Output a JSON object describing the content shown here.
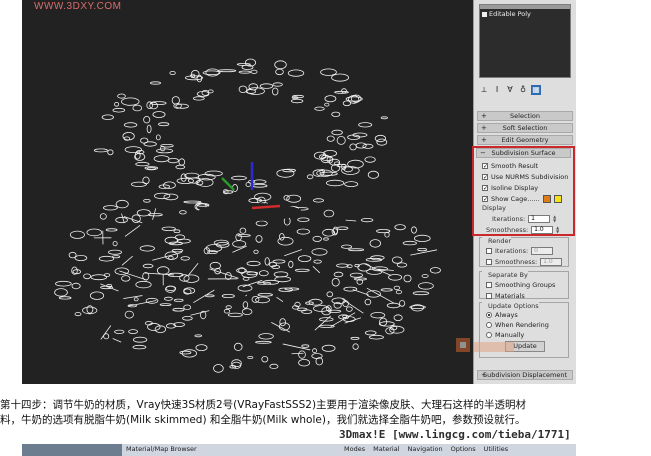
{
  "watermark_top": "WWW.3DXY.COM",
  "viewport": {
    "label": "wireframe-viewport"
  },
  "panel": {
    "modifier_item": "Editable Poly",
    "rollouts": {
      "selection": "Selection",
      "soft_selection": "Soft Selection",
      "edit_geometry": "Edit Geometry",
      "subdivision_surface": "Subdivision Surface",
      "subdivision_displacement": "Subdivision Displacement"
    },
    "subdivision": {
      "smooth_result": "Smooth Result",
      "use_nurms": "Use NURMS Subdivision",
      "isoline_display": "Isoline Display",
      "show_cage": "Show Cage......",
      "display_label": "Display",
      "iterations_label": "Iterations:",
      "iterations_value": "1",
      "smoothness_label": "Smoothness:",
      "smoothness_value": "1.0",
      "cage_colors": [
        "#e07b17",
        "#f5e21a"
      ]
    },
    "render": {
      "label": "Render",
      "iterations_label": "Iterations:",
      "iterations_value": "0",
      "smoothness_label": "Smoothness:",
      "smoothness_value": "1.0"
    },
    "separate_by": {
      "label": "Separate By",
      "smoothing_groups": "Smoothing Groups",
      "materials": "Materials"
    },
    "update_options": {
      "label": "Update Options",
      "always": "Always",
      "when_rendering": "When Rendering",
      "manually": "Manually",
      "update_button": "Update"
    }
  },
  "caption": {
    "line1": "第十四步：调节牛奶的材质，Vray快速3S材质2号(VRayFastSSS2)主要用于渲染像皮肤、大理石这样的半透明材",
    "line2": "料，牛奶的选项有脱脂牛奶(Milk skimmed) 和全脂牛奶(Milk whole)，我们就选择全脂牛奶吧，参数预设就行。"
  },
  "watermark_bottom": "3Dmax!E  [www.lingcg.com/tieba/1771]",
  "bottom_strip": {
    "title": "Material/Map Browser",
    "menus": [
      "Modes",
      "Material",
      "Navigation",
      "Options",
      "Utilities"
    ]
  }
}
